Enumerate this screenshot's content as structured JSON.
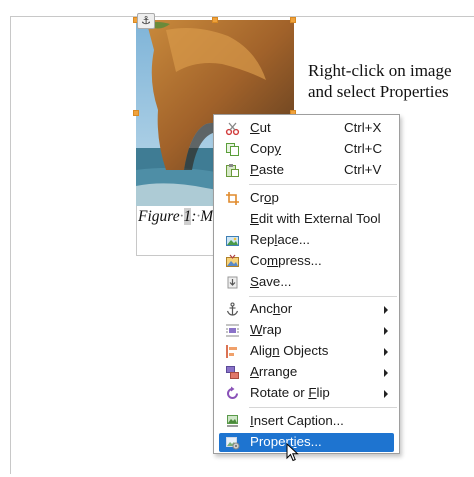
{
  "instruction": {
    "line1": "Right-click on image",
    "line2": "and select Properties"
  },
  "caption": {
    "prefix": "Figure",
    "number": "1",
    "sep": ":",
    "rest": "M"
  },
  "context_menu": {
    "items": [
      {
        "pre": "",
        "u": "C",
        "post": "ut",
        "shortcut": "Ctrl+X",
        "icon": "cut-icon"
      },
      {
        "pre": "Cop",
        "u": "y",
        "post": "",
        "shortcut": "Ctrl+C",
        "icon": "copy-icon"
      },
      {
        "pre": "",
        "u": "P",
        "post": "aste",
        "shortcut": "Ctrl+V",
        "icon": "paste-icon"
      },
      {
        "pre": "Cr",
        "u": "o",
        "post": "p",
        "shortcut": "",
        "icon": "crop-icon"
      },
      {
        "pre": "",
        "u": "E",
        "post": "dit with External Tool",
        "shortcut": "",
        "icon": ""
      },
      {
        "pre": "Rep",
        "u": "l",
        "post": "ace...",
        "shortcut": "",
        "icon": "replace-icon"
      },
      {
        "pre": "Co",
        "u": "m",
        "post": "press...",
        "shortcut": "",
        "icon": "compress-icon"
      },
      {
        "pre": "",
        "u": "S",
        "post": "ave...",
        "shortcut": "",
        "icon": "save-icon"
      },
      {
        "pre": "Anc",
        "u": "h",
        "post": "or",
        "shortcut": "",
        "icon": "anchor-icon"
      },
      {
        "pre": "",
        "u": "W",
        "post": "rap",
        "shortcut": "",
        "icon": "wrap-icon"
      },
      {
        "pre": "Alig",
        "u": "n",
        "post": " Objects",
        "shortcut": "",
        "icon": "align-objects-icon"
      },
      {
        "pre": "",
        "u": "A",
        "post": "rrange",
        "shortcut": "",
        "icon": "arrange-icon"
      },
      {
        "pre": "Rotate or ",
        "u": "F",
        "post": "lip",
        "shortcut": "",
        "icon": "rotate-flip-icon"
      },
      {
        "pre": "",
        "u": "I",
        "post": "nsert Caption...",
        "shortcut": "",
        "icon": "insert-caption-icon"
      },
      {
        "pre": "Propert",
        "u": "i",
        "post": "es...",
        "shortcut": "",
        "icon": "properties-icon"
      }
    ]
  },
  "colors": {
    "highlight": "#1e74d0",
    "handle": "#f0a23c"
  }
}
